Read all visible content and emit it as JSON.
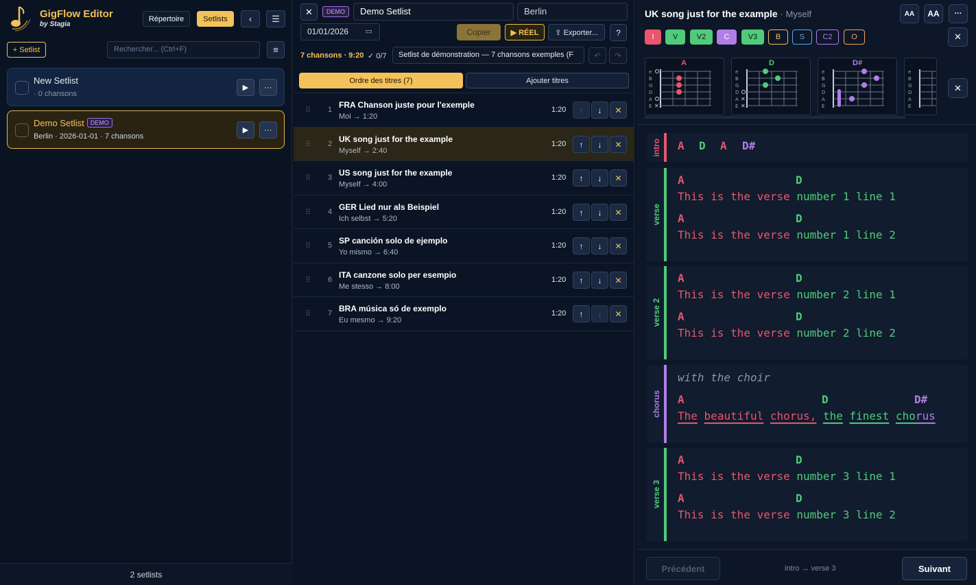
{
  "app": {
    "brand": "GigFlow Editor",
    "byline": "by Stagia"
  },
  "left": {
    "repertoire_label": "Répertoire",
    "setlists_label": "Setlists",
    "back_icon": "chevron-left-icon",
    "menu_icon": "hamburger-menu-icon",
    "add_setlist_label": "+ Setlist",
    "search_placeholder": "Rechercher... (Ctrl+F)",
    "cards": [
      {
        "title": "New Setlist",
        "sub": "· 0 chansons",
        "badge": ""
      },
      {
        "title": "Demo Setlist",
        "badge": "DEMO",
        "sub": "Berlin  ·  2026-01-01  · 7 chansons"
      }
    ],
    "footer": "2 setlists"
  },
  "editor": {
    "demo_badge": "DEMO",
    "name": "Demo Setlist",
    "city": "Berlin",
    "date": "01/01/2026",
    "copy_label": "Copier",
    "live_label": "▶ RÉEL",
    "export_label": "Exporter...",
    "help_label": "?",
    "stats": "7 chansons · 9:20",
    "checked": "✓ 0/7",
    "description": "Setlist de démonstration — 7 chansons exemples (F",
    "tab_order": "Ordre des titres (7)",
    "tab_add": "Ajouter titres",
    "songs": [
      {
        "n": "1",
        "title": "FRA Chanson juste pour l'exemple",
        "sub": "Moi  → 1:20",
        "dur": "1:20"
      },
      {
        "n": "2",
        "title": "UK song just for the example",
        "sub": "Myself  → 2:40",
        "dur": "1:20"
      },
      {
        "n": "3",
        "title": "US song just for the example",
        "sub": "Myself  → 4:00",
        "dur": "1:20"
      },
      {
        "n": "4",
        "title": "GER Lied nur als Beispiel",
        "sub": "Ich selbst  → 5:20",
        "dur": "1:20"
      },
      {
        "n": "5",
        "title": "SP canción solo de ejemplo",
        "sub": "Yo mismo  → 6:40",
        "dur": "1:20"
      },
      {
        "n": "6",
        "title": "ITA canzone solo per esempio",
        "sub": "Me stesso  → 8:00",
        "dur": "1:20"
      },
      {
        "n": "7",
        "title": "BRA música só de exemplo",
        "sub": "Eu mesmo  → 9:20",
        "dur": "1:20"
      }
    ]
  },
  "viewer": {
    "title": "UK song just for the example",
    "artist": "· Myself",
    "font_small": "AA",
    "font_large": "AA",
    "more": "···",
    "chips": [
      "I",
      "V",
      "V2",
      "C",
      "V3",
      "B",
      "S",
      "C2",
      "O"
    ],
    "chord_names": [
      "A",
      "D",
      "D#"
    ],
    "sections": [
      {
        "label": "intro",
        "chords": [
          "A",
          "D",
          "A",
          "D#"
        ]
      },
      {
        "label": "verse",
        "lines": [
          {
            "chord_a": "A",
            "chord_d": "D",
            "lyric": "This is the verse number 1 line 1"
          },
          {
            "chord_a": "A",
            "chord_d": "D",
            "lyric": "This is the verse number 1 line 2"
          }
        ]
      },
      {
        "label": "verse 2",
        "lines": [
          {
            "chord_a": "A",
            "chord_d": "D",
            "lyric": "This is the verse number 2 line 1"
          },
          {
            "chord_a": "A",
            "chord_d": "D",
            "lyric": "This is the verse number 2 line 2"
          }
        ]
      },
      {
        "label": "chorus",
        "comment": "with the choir",
        "chords": [
          "A",
          "D",
          "D#"
        ],
        "words": [
          "The",
          "beautiful",
          "chorus,",
          "the",
          "finest",
          "cho",
          "rus"
        ]
      },
      {
        "label": "verse 3",
        "lines": [
          {
            "chord_a": "A",
            "chord_d": "D",
            "lyric": "This is the verse number 3 line 1"
          },
          {
            "chord_a": "A",
            "chord_d": "D",
            "lyric": "This is the verse number 3 line 2"
          }
        ]
      }
    ],
    "prev_label": "Précédent",
    "nav_text": "intro → verse 3",
    "next_label": "Suivant"
  },
  "colors": {
    "accent": "#f4c25a",
    "intro": "#e8566c",
    "verse": "#4fcb7a",
    "chorus": "#b27de8",
    "blue": "#5aa7f0"
  }
}
